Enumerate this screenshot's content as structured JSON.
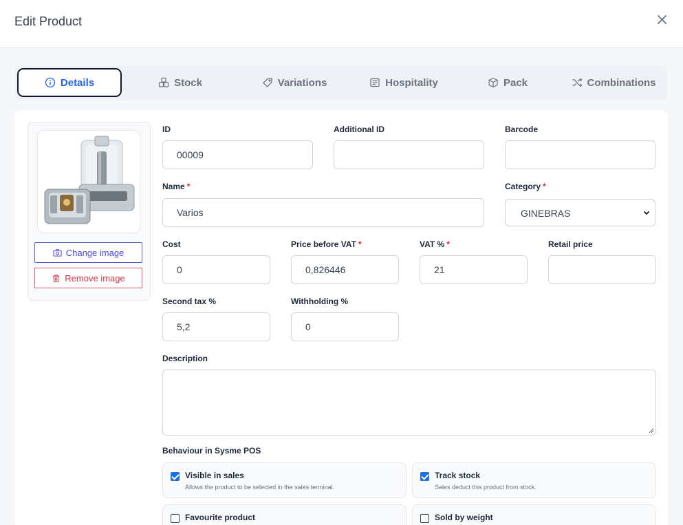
{
  "modal": {
    "title": "Edit Product"
  },
  "tabs": [
    {
      "label": "Details",
      "active": true
    },
    {
      "label": "Stock"
    },
    {
      "label": "Variations"
    },
    {
      "label": "Hospitality"
    },
    {
      "label": "Pack"
    },
    {
      "label": "Combinations"
    }
  ],
  "image": {
    "change_label": "Change image",
    "remove_label": "Remove image"
  },
  "fields": {
    "id": {
      "label": "ID",
      "value": "00009"
    },
    "additional_id": {
      "label": "Additional ID",
      "value": ""
    },
    "barcode": {
      "label": "Barcode",
      "value": ""
    },
    "name": {
      "label": "Name",
      "required": "*",
      "value": "Varios"
    },
    "category": {
      "label": "Category",
      "required": "*",
      "value": "GINEBRAS"
    },
    "cost": {
      "label": "Cost",
      "value": "0"
    },
    "price_before_vat": {
      "label": "Price before VAT",
      "required": "*",
      "value": "0,826446"
    },
    "vat": {
      "label": "VAT %",
      "required": "*",
      "value": "21"
    },
    "retail_price": {
      "label": "Retail price",
      "value": ""
    },
    "second_tax": {
      "label": "Second tax %",
      "value": "5,2"
    },
    "withholding": {
      "label": "Withholding %",
      "value": "0"
    },
    "description": {
      "label": "Description",
      "value": ""
    }
  },
  "behaviour": {
    "heading": "Behaviour in Sysme POS",
    "options": [
      {
        "title": "Visible in sales",
        "desc": "Allows the product to be selected in the sales terminal.",
        "checked": true
      },
      {
        "title": "Track stock",
        "desc": "Sales deduct this product from stock.",
        "checked": true
      },
      {
        "title": "Favourite product",
        "desc": "",
        "checked": false
      },
      {
        "title": "Sold by weight",
        "desc": "",
        "checked": false
      }
    ]
  },
  "colors": {
    "accent": "#2563eb",
    "danger": "#dc3545",
    "checkbox": "#1d6fe8"
  }
}
